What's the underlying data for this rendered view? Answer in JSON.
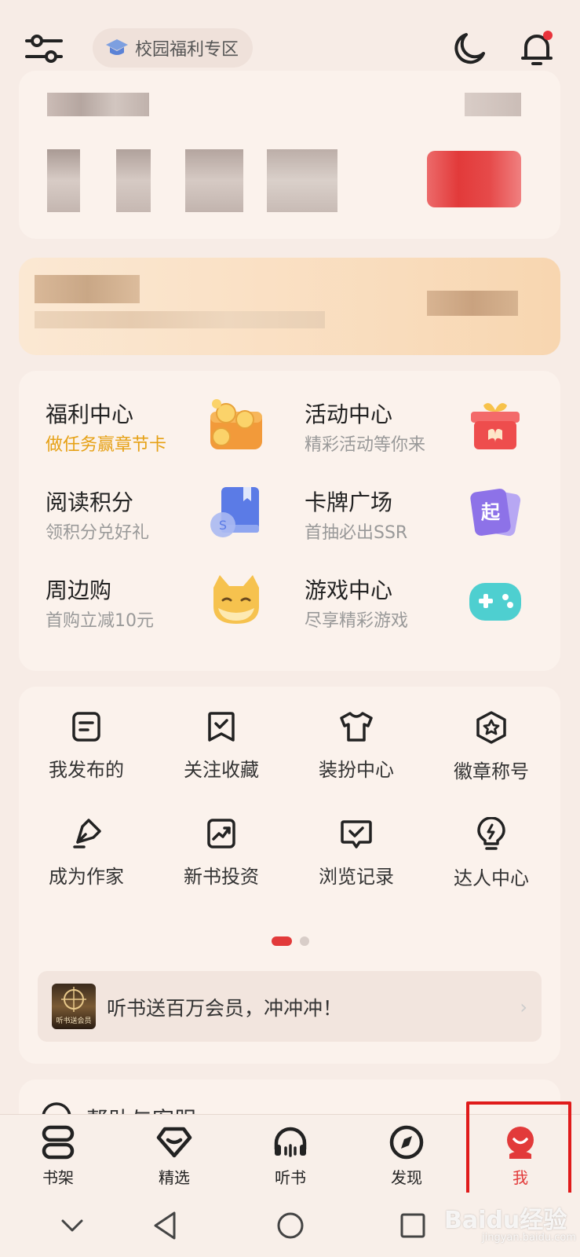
{
  "header": {
    "campus_label": "校园福利专区",
    "icons": [
      "filter-sliders-icon",
      "graduation-cap-icon",
      "moon-icon",
      "bell-icon"
    ],
    "notification_dot_color": "#e8333b"
  },
  "services": [
    {
      "title": "福利中心",
      "subtitle": "做任务赢章节卡",
      "icon": "coins-icon",
      "highlight": true
    },
    {
      "title": "活动中心",
      "subtitle": "精彩活动等你来",
      "icon": "gift-box-icon",
      "highlight": false
    },
    {
      "title": "阅读积分",
      "subtitle": "领积分兑好礼",
      "icon": "book-coin-icon",
      "highlight": false
    },
    {
      "title": "卡牌广场",
      "subtitle": "首抽必出SSR",
      "icon": "cards-icon",
      "highlight": false
    },
    {
      "title": "周边购",
      "subtitle": "首购立减10元",
      "icon": "cat-mascot-icon",
      "highlight": false
    },
    {
      "title": "游戏中心",
      "subtitle": "尽享精彩游戏",
      "icon": "gamepad-icon",
      "highlight": false
    }
  ],
  "card_icon_char": "起",
  "actions": [
    {
      "label": "我发布的",
      "icon": "document-icon"
    },
    {
      "label": "关注收藏",
      "icon": "bookmark-check-icon"
    },
    {
      "label": "装扮中心",
      "icon": "tshirt-icon"
    },
    {
      "label": "徽章称号",
      "icon": "badge-star-icon"
    },
    {
      "label": "成为作家",
      "icon": "pen-nib-icon"
    },
    {
      "label": "新书投资",
      "icon": "chart-up-icon"
    },
    {
      "label": "浏览记录",
      "icon": "history-chat-icon"
    },
    {
      "label": "达人中心",
      "icon": "lightbulb-icon"
    }
  ],
  "pager": {
    "pages": 2,
    "current": 1,
    "active_color": "#e23a3a"
  },
  "promo": {
    "text": "听书送百万会员，冲冲冲！",
    "thumb_caption": "听书送会员"
  },
  "help": {
    "label": "帮助与客服"
  },
  "bottom_nav": {
    "items": [
      {
        "label": "书架",
        "icon": "bookshelf-icon"
      },
      {
        "label": "精选",
        "icon": "diamond-icon"
      },
      {
        "label": "听书",
        "icon": "headphones-icon"
      },
      {
        "label": "发现",
        "icon": "compass-icon"
      },
      {
        "label": "我",
        "icon": "profile-icon"
      }
    ],
    "active": "我",
    "active_color": "#e23a3a"
  },
  "watermark": {
    "text": "Baidu经验",
    "sub": "jingyan.baidu.com"
  }
}
